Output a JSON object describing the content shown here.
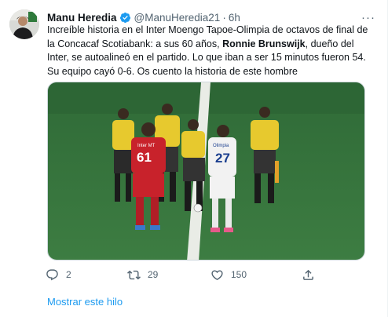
{
  "author": {
    "name": "Manu Heredia",
    "handle": "@ManuHeredia21",
    "separator": "·",
    "time": "6h",
    "verified": true
  },
  "tweet": {
    "text_part1": "Increíble historia en el Inter Moengo Tapoe-Olimpia de octavos de final de la Concacaf Scotiabank: a sus 60 años, ",
    "text_bold": "Ronnie Brunswijk",
    "text_part2": ", dueño del Inter, se autoalineó en el partido. Lo que iban a ser 15 minutos fueron 54. Su equipo cayó 0-6. Os cuento la historia de este hombre"
  },
  "media": {
    "jersey_red_text": "Inter MT",
    "jersey_red_number": "61",
    "jersey_white_text": "Olimpia",
    "jersey_white_number": "27"
  },
  "actions": {
    "reply_count": "2",
    "retweet_count": "29",
    "like_count": "150"
  },
  "show_thread_label": "Mostrar este hilo",
  "colors": {
    "accent": "#1d9bf0",
    "muted": "#536471",
    "text": "#0f1419"
  },
  "icons": [
    "verified-badge-icon",
    "more-icon",
    "reply-icon",
    "retweet-icon",
    "like-icon",
    "share-icon"
  ]
}
